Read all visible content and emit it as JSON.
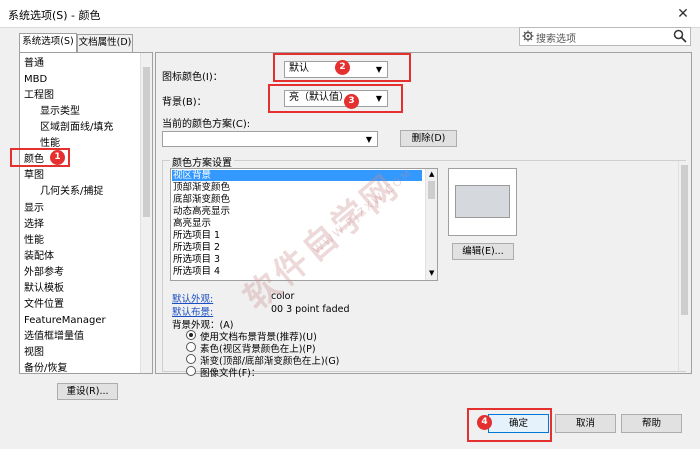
{
  "window": {
    "title": "系统选项(S) - 颜色",
    "close": "✕"
  },
  "tabs": [
    {
      "label": "系统选项(S)"
    },
    {
      "label": "文档属性(D)"
    }
  ],
  "search": {
    "placeholder": "搜索选项"
  },
  "sidebar": {
    "items": [
      {
        "label": "普通"
      },
      {
        "label": "MBD"
      },
      {
        "label": "工程图"
      },
      {
        "label": "显示类型"
      },
      {
        "label": "区域剖面线/填充"
      },
      {
        "label": "性能"
      },
      {
        "label": "颜色"
      },
      {
        "label": "草图"
      },
      {
        "label": "几何关系/捕捉"
      },
      {
        "label": "显示"
      },
      {
        "label": "选择"
      },
      {
        "label": "性能"
      },
      {
        "label": "装配体"
      },
      {
        "label": "外部参考"
      },
      {
        "label": "默认模板"
      },
      {
        "label": "文件位置"
      },
      {
        "label": "FeatureManager"
      },
      {
        "label": "选值框增量值"
      },
      {
        "label": "视图"
      },
      {
        "label": "备份/恢复"
      }
    ],
    "reset_button": "重设(R)..."
  },
  "main": {
    "icon_color_label": "图标颜色(I)：",
    "icon_color_value": "默认",
    "background_label": "背景(B)：",
    "background_value": "亮（默认值）",
    "scheme_label": "当前的颜色方案(C):",
    "scheme_value": "",
    "delete_button": "删除(D)",
    "group_title": "颜色方案设置",
    "color_items": [
      {
        "label": "视区背景"
      },
      {
        "label": "顶部渐变颜色"
      },
      {
        "label": "底部渐变颜色"
      },
      {
        "label": "动态高亮显示"
      },
      {
        "label": "高亮显示"
      },
      {
        "label": "所选项目 1"
      },
      {
        "label": "所选项目 2"
      },
      {
        "label": "所选项目 3"
      },
      {
        "label": "所选项目 4"
      }
    ],
    "edit_button": "编辑(E)...",
    "default_appearance_link": "默认外观:",
    "default_appearance_value": "color",
    "default_layout_link": "默认布景:",
    "default_layout_value": "00 3 point faded",
    "bg_appearance_label": "背景外观：(A)",
    "radio_options": [
      {
        "label": "使用文档布景背景(推荐)(U)"
      },
      {
        "label": "素色(视区背景颜色在上)(P)"
      },
      {
        "label": "渐变(顶部/底部渐变颜色在上)(G)"
      },
      {
        "label": "图像文件(F)："
      }
    ]
  },
  "footer": {
    "ok_button": "确定",
    "cancel_button": "取消",
    "help_button": "帮助"
  },
  "annotations": {
    "badge1": "1",
    "badge2": "2",
    "badge3": "3",
    "badge4": "4"
  },
  "watermark": {
    "cn": "软件自学网",
    "en": "WWW.RJZXW.COM"
  },
  "colors": {
    "highlight": "#e53030",
    "selection": "#3399ff",
    "link": "#1a4fc3"
  }
}
